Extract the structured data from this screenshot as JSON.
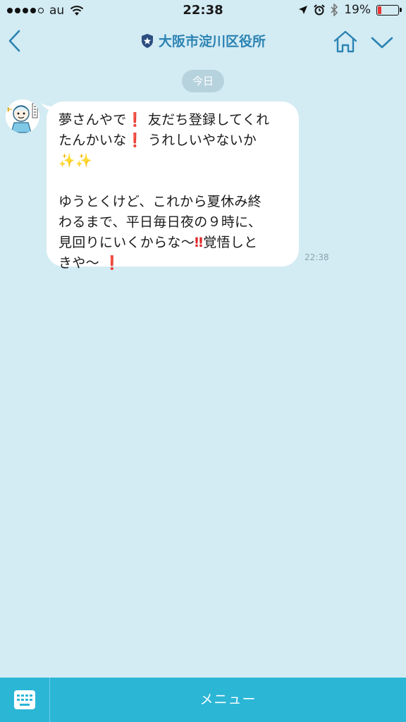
{
  "status_bar": {
    "carrier": "au",
    "time": "22:38",
    "battery_percent_label": "19%",
    "battery_level": 0.19,
    "signal_bars_filled": 4,
    "signal_bars_total": 5
  },
  "header": {
    "title": "大阪市淀川区役所",
    "accent_color": "#2b83b3"
  },
  "chat": {
    "date_label": "今日",
    "messages": [
      {
        "paragraph1": {
          "lines": [
            {
              "parts": [
                {
                  "t": "夢さんやで"
                },
                {
                  "t": "❗",
                  "c": "ex"
                },
                {
                  "t": " 友だち登録してくれ"
                }
              ]
            },
            {
              "parts": [
                {
                  "t": "たんかいな"
                },
                {
                  "t": "❗",
                  "c": "ex"
                },
                {
                  "t": " うれしいやないか"
                }
              ]
            },
            {
              "parts": [
                {
                  "t": "✨✨",
                  "c": "spark"
                }
              ]
            }
          ]
        },
        "paragraph2": {
          "lines": [
            {
              "parts": [
                {
                  "t": "ゆうとくけど、これから夏休み終"
                }
              ]
            },
            {
              "parts": [
                {
                  "t": "わるまで、平日毎日夜の９時に、"
                }
              ]
            },
            {
              "parts": [
                {
                  "t": "見回りにいくからな〜"
                },
                {
                  "t": "‼",
                  "c": "ex"
                },
                {
                  "t": "覚悟しと"
                }
              ]
            },
            {
              "parts": [
                {
                  "t": "きや〜 "
                },
                {
                  "t": "❗",
                  "c": "ex"
                }
              ]
            }
          ]
        },
        "time": "22:38"
      }
    ]
  },
  "bottom_bar": {
    "menu_label": "メニュー",
    "color": "#2bb6d6"
  }
}
